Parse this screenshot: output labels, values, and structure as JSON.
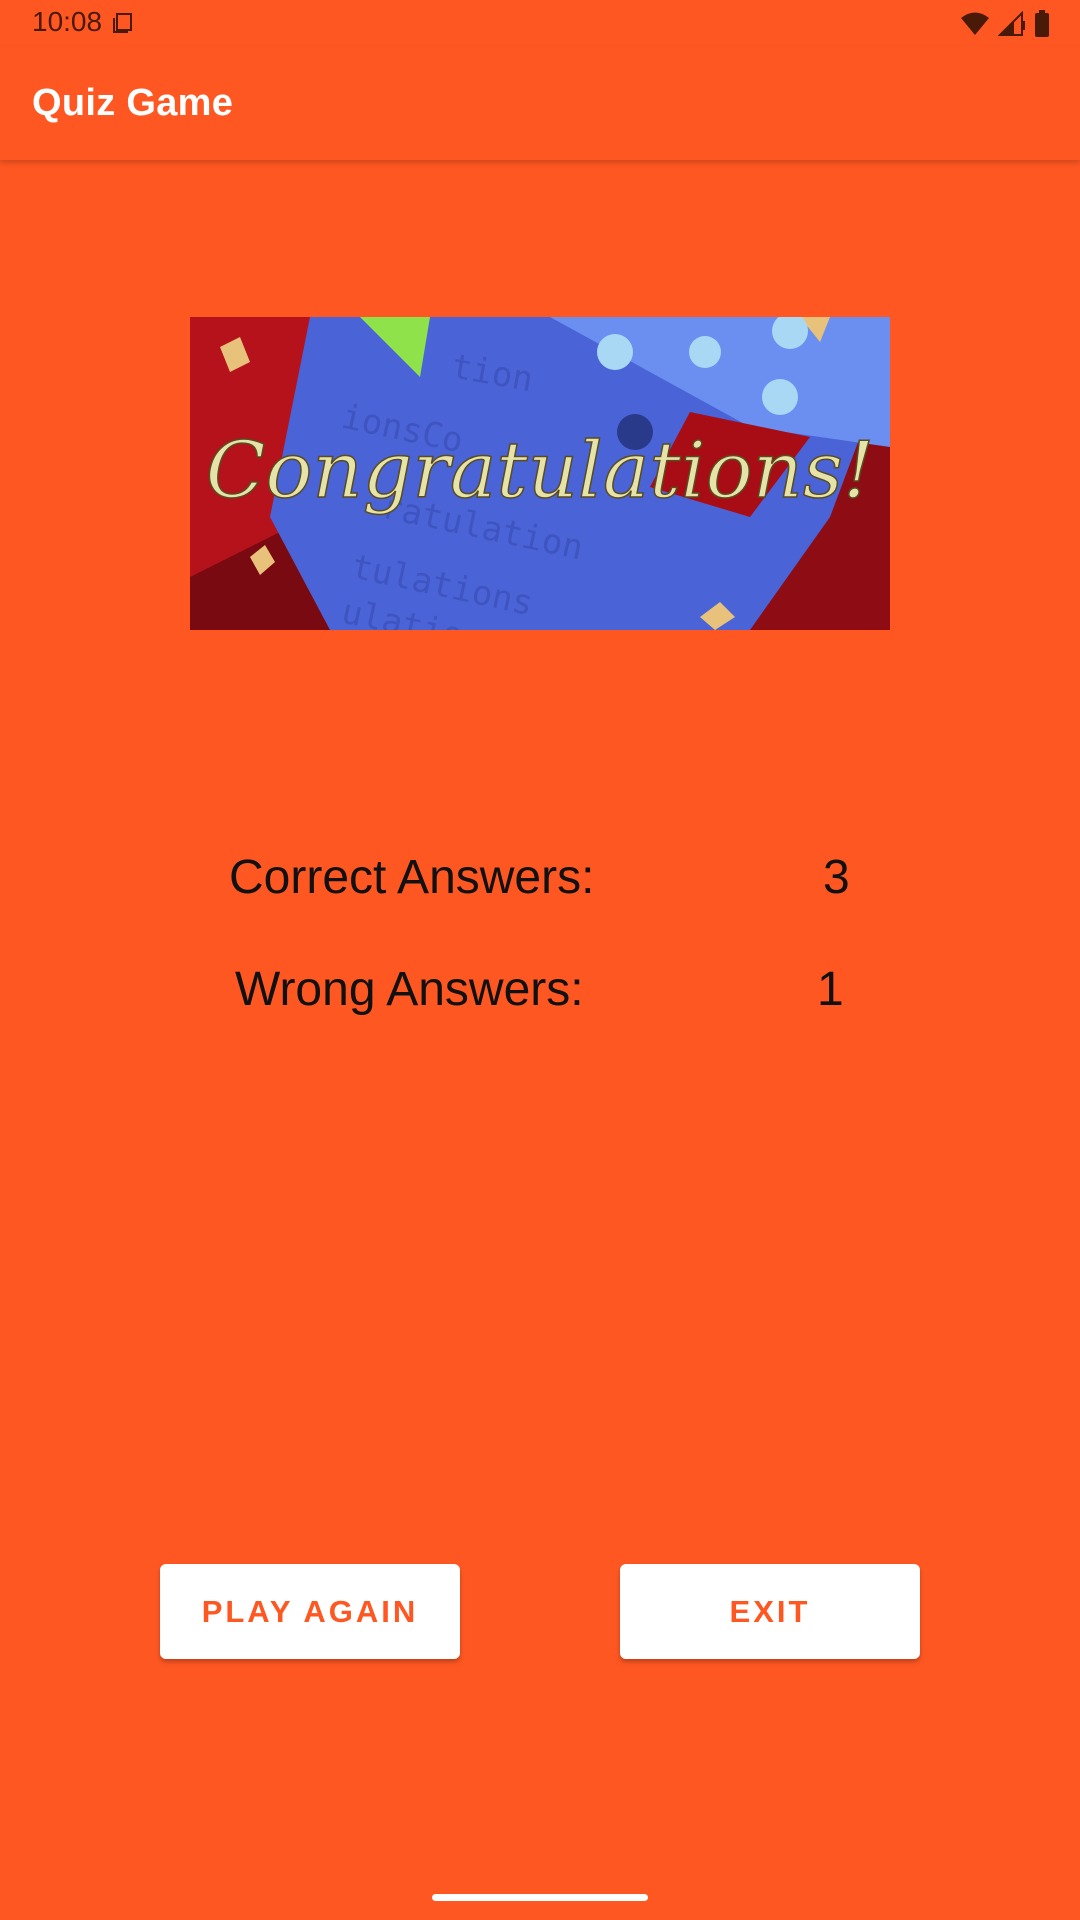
{
  "status_bar": {
    "time": "10:08",
    "icons": [
      "sim-card-icon",
      "wifi-icon",
      "cell-signal-icon",
      "battery-icon"
    ]
  },
  "app_bar": {
    "title": "Quiz Game"
  },
  "banner": {
    "text": "Congratulations!"
  },
  "results": {
    "correct_label": "Correct Answers:",
    "correct_value": "3",
    "wrong_label": "Wrong Answers:",
    "wrong_value": "1"
  },
  "actions": {
    "play_again_label": "PLAY AGAIN",
    "exit_label": "EXIT"
  },
  "colors": {
    "primary": "#FF5722",
    "button_bg": "#ffffff",
    "button_text": "#FF5722",
    "text": "#111111"
  }
}
